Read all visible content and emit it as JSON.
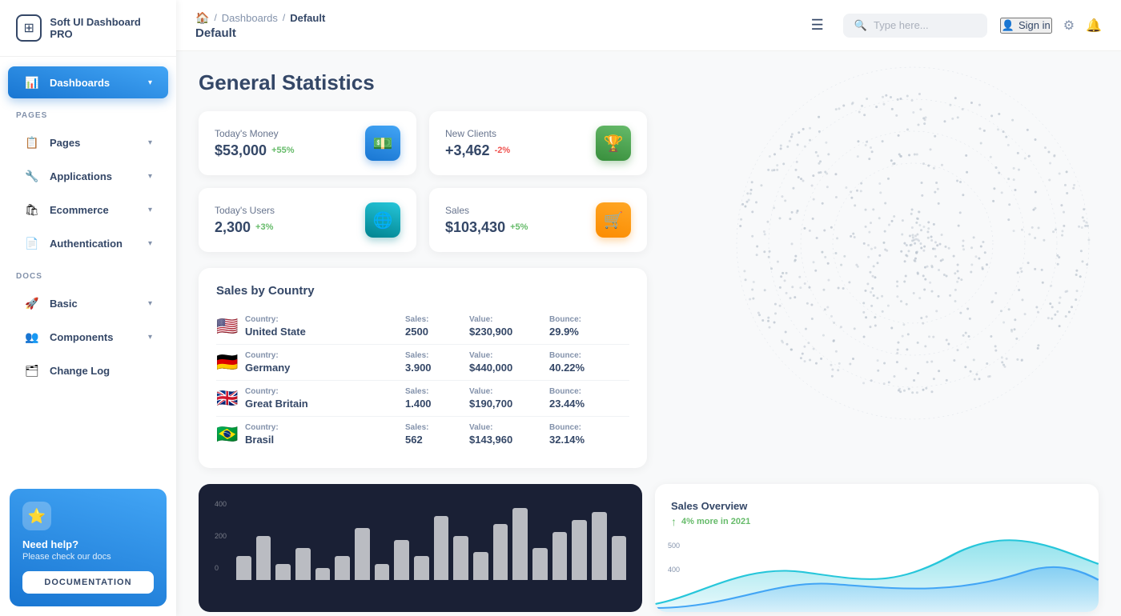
{
  "app": {
    "name": "Soft UI Dashboard PRO"
  },
  "topbar": {
    "breadcrumb": {
      "home_icon": "🏠",
      "separator": "/",
      "dashboards": "Dashboards",
      "current": "Default"
    },
    "page_title": "Default",
    "menu_icon": "☰",
    "search_placeholder": "Type here...",
    "sign_in": "Sign in",
    "settings_icon": "⚙",
    "bell_icon": "🔔"
  },
  "sidebar": {
    "section_pages": "PAGES",
    "section_docs": "DOCS",
    "items_pages": [
      {
        "id": "dashboards",
        "label": "Dashboards",
        "icon": "📊",
        "active": true
      },
      {
        "id": "pages",
        "label": "Pages",
        "icon": "📋",
        "active": false
      },
      {
        "id": "applications",
        "label": "Applications",
        "icon": "🔧",
        "active": false
      },
      {
        "id": "ecommerce",
        "label": "Ecommerce",
        "icon": "🛍",
        "active": false
      },
      {
        "id": "authentication",
        "label": "Authentication",
        "icon": "📄",
        "active": false
      }
    ],
    "items_docs": [
      {
        "id": "basic",
        "label": "Basic",
        "icon": "🚀",
        "active": false
      },
      {
        "id": "components",
        "label": "Components",
        "icon": "👥",
        "active": false
      },
      {
        "id": "changelog",
        "label": "Change Log",
        "icon": "🗂",
        "active": false
      }
    ],
    "help": {
      "star_icon": "⭐",
      "title": "Need help?",
      "subtitle": "Please check our docs",
      "button_label": "DOCUMENTATION"
    }
  },
  "page": {
    "title": "General Statistics"
  },
  "stats": [
    {
      "id": "money",
      "label": "Today's Money",
      "value": "$53,000",
      "badge": "+55%",
      "badge_type": "pos",
      "icon": "💵",
      "icon_style": "blue"
    },
    {
      "id": "clients",
      "label": "New Clients",
      "value": "+3,462",
      "badge": "-2%",
      "badge_type": "neg",
      "icon": "🏆",
      "icon_style": "green"
    },
    {
      "id": "users",
      "label": "Today's Users",
      "value": "2,300",
      "badge": "+3%",
      "badge_type": "pos",
      "icon": "🌐",
      "icon_style": "blue2"
    },
    {
      "id": "sales",
      "label": "Sales",
      "value": "$103,430",
      "badge": "+5%",
      "badge_type": "pos",
      "icon": "🛒",
      "icon_style": "orange"
    }
  ],
  "sales_by_country": {
    "title": "Sales by Country",
    "columns": {
      "country": "Country:",
      "sales": "Sales:",
      "value": "Value:",
      "bounce": "Bounce:"
    },
    "rows": [
      {
        "flag": "🇺🇸",
        "country": "United State",
        "sales": "2500",
        "value": "$230,900",
        "bounce": "29.9%"
      },
      {
        "flag": "🇩🇪",
        "country": "Germany",
        "sales": "3.900",
        "value": "$440,000",
        "bounce": "40.22%"
      },
      {
        "flag": "🇬🇧",
        "country": "Great Britain",
        "sales": "1.400",
        "value": "$190,700",
        "bounce": "23.44%"
      },
      {
        "flag": "🇧🇷",
        "country": "Brasil",
        "sales": "562",
        "value": "$143,960",
        "bounce": "32.14%"
      }
    ]
  },
  "bar_chart": {
    "y_labels": [
      "400",
      "200",
      "0"
    ],
    "bars": [
      {
        "height": 30,
        "label": ""
      },
      {
        "height": 55,
        "label": ""
      },
      {
        "height": 20,
        "label": ""
      },
      {
        "height": 40,
        "label": ""
      },
      {
        "height": 15,
        "label": ""
      },
      {
        "height": 30,
        "label": ""
      },
      {
        "height": 65,
        "label": ""
      },
      {
        "height": 20,
        "label": ""
      },
      {
        "height": 50,
        "label": ""
      },
      {
        "height": 30,
        "label": ""
      },
      {
        "height": 80,
        "label": ""
      },
      {
        "height": 55,
        "label": ""
      },
      {
        "height": 35,
        "label": ""
      },
      {
        "height": 70,
        "label": ""
      },
      {
        "height": 90,
        "label": ""
      },
      {
        "height": 40,
        "label": ""
      },
      {
        "height": 60,
        "label": ""
      },
      {
        "height": 75,
        "label": ""
      },
      {
        "height": 85,
        "label": ""
      },
      {
        "height": 55,
        "label": ""
      }
    ]
  },
  "sales_overview": {
    "title": "Sales Overview",
    "badge": "4% more in 2021",
    "y_labels": [
      "500",
      "400"
    ]
  }
}
